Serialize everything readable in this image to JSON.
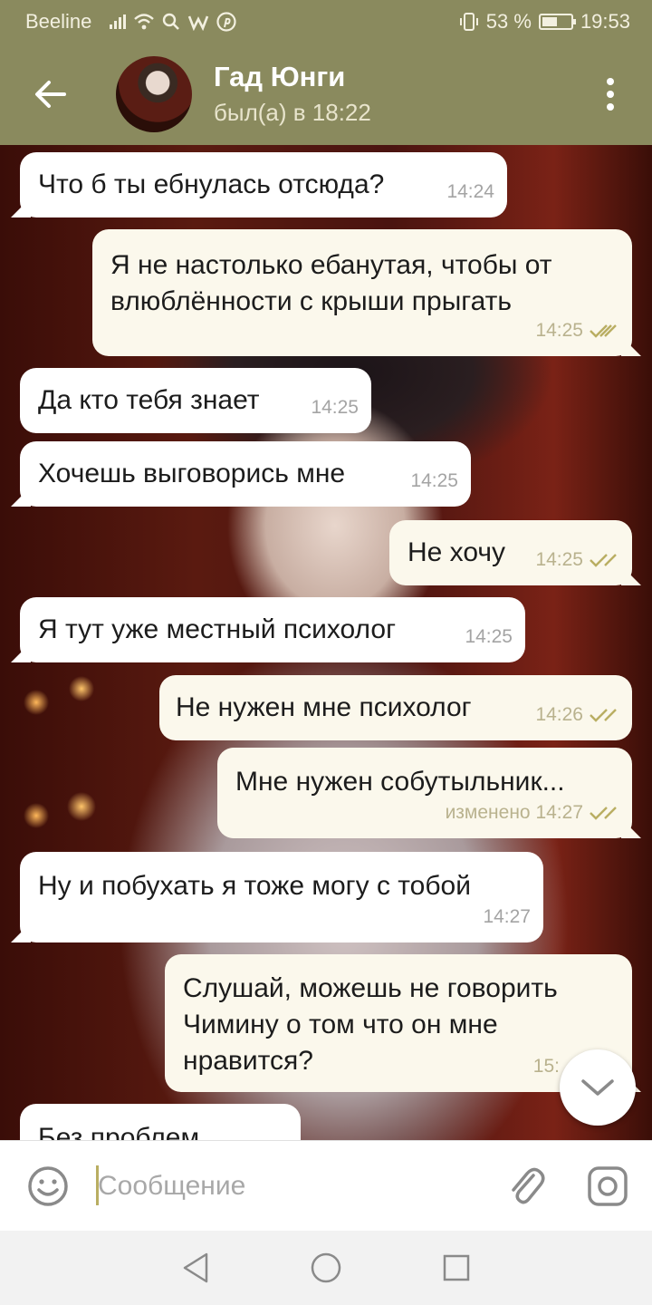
{
  "status_bar": {
    "carrier": "Beeline",
    "battery": "53 %",
    "battery_level": 0.53,
    "time": "19:53"
  },
  "header": {
    "contact_name": "Гад Юнги",
    "last_seen": "был(а) в 18:22",
    "back_icon": "arrow-left-icon",
    "menu_icon": "more-vertical-icon"
  },
  "messages": [
    {
      "dir": "in",
      "text": "Что б ты ебнулась отсюда?",
      "time": "14:24"
    },
    {
      "dir": "out",
      "text": "Я не настолько ебанутая, чтобы от влюблённости с крыши прыгать",
      "time": "14:25",
      "read": true
    },
    {
      "dir": "in",
      "text": "Да кто тебя знает",
      "time": "14:25"
    },
    {
      "dir": "in",
      "text": "Хочешь выговорись мне",
      "time": "14:25"
    },
    {
      "dir": "out",
      "text": "Не хочу",
      "time": "14:25",
      "read": true
    },
    {
      "dir": "in",
      "text": "Я тут уже местный психолог",
      "time": "14:25"
    },
    {
      "dir": "out",
      "text": "Не нужен мне психолог",
      "time": "14:26",
      "read": true
    },
    {
      "dir": "out",
      "text": "Мне нужен собутыльник...",
      "time": "изменено 14:27",
      "read": true
    },
    {
      "dir": "in",
      "text": "Ну и побухать я тоже могу с тобой",
      "time": "14:27"
    },
    {
      "dir": "out",
      "text": "Слушай, можешь не говорить Чимину о том что он мне нравится?",
      "time": "15:",
      "read": true
    },
    {
      "dir": "in",
      "text": "Без проблем",
      "time": ""
    }
  ],
  "input": {
    "placeholder": "Сообщение",
    "emoji_icon": "smile-icon",
    "attach_icon": "paperclip-icon",
    "camera_icon": "camera-icon"
  },
  "colors": {
    "header_bg": "#8a8a5e",
    "bubble_in": "#ffffff",
    "bubble_out": "#fbf8ec",
    "tick_color": "#b9ae62"
  }
}
